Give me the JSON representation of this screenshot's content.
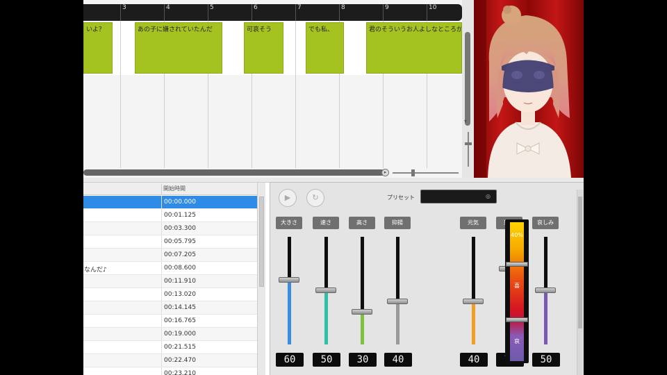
{
  "timeline": {
    "ruler_ticks": [
      "3",
      "4",
      "5",
      "6",
      "7",
      "8",
      "9",
      "10"
    ],
    "clips": [
      {
        "text": "いよ？"
      },
      {
        "text": "あの子に嫌されていたんだ"
      },
      {
        "text": "可哀そう"
      },
      {
        "text": "でも私、"
      },
      {
        "text": "君のそういうお人よしなところが"
      }
    ]
  },
  "avatar": {
    "name": "avatar-character"
  },
  "list": {
    "column_start_time": "開始時間",
    "rows": [
      {
        "text": "",
        "time": "00:00.000",
        "selected": true
      },
      {
        "text": "",
        "time": "00:01.125"
      },
      {
        "text": "",
        "time": "00:03.300"
      },
      {
        "text": "",
        "time": "00:05.795"
      },
      {
        "text": "",
        "time": "00:07.205"
      },
      {
        "text": "なんだ♪",
        "time": "00:08.600"
      },
      {
        "text": "",
        "time": "00:11.910"
      },
      {
        "text": "",
        "time": "00:13.020"
      },
      {
        "text": "",
        "time": "00:14.145"
      },
      {
        "text": "",
        "time": "00:16.765"
      },
      {
        "text": "",
        "time": "00:19.000"
      },
      {
        "text": "",
        "time": "00:21.515"
      },
      {
        "text": "",
        "time": "00:22.470"
      },
      {
        "text": "",
        "time": "00:23.210"
      }
    ]
  },
  "mixer": {
    "play_icon": "play-icon",
    "loop_icon": "loop-icon",
    "preset_label": "プリセット",
    "preset_value": "",
    "sliders": [
      {
        "key": "volume",
        "label": "大きさ",
        "value": "60",
        "level": 0.6,
        "color": "#3a8ee0"
      },
      {
        "key": "speed",
        "label": "速さ",
        "value": "50",
        "level": 0.5,
        "color": "#2fc0a8"
      },
      {
        "key": "pitch",
        "label": "高さ",
        "value": "30",
        "level": 0.3,
        "color": "#7fc040"
      },
      {
        "key": "intonation",
        "label": "抑揚",
        "value": "40",
        "level": 0.4,
        "color": "#9a9a9a"
      },
      {
        "key": "normal",
        "label": "元気",
        "value": "40",
        "level": 0.4,
        "color": "#f0a020"
      },
      {
        "key": "anger",
        "label": "怒り",
        "value": "70",
        "level": 0.7,
        "color": "#d91c2a"
      },
      {
        "key": "sad",
        "label": "哀しみ",
        "value": "50",
        "level": 0.5,
        "color": "#7a5ab0"
      }
    ],
    "emotion": {
      "labels": [
        "40%",
        "喜",
        "哀"
      ],
      "thumb_levels": [
        0.7,
        0.3
      ]
    }
  }
}
